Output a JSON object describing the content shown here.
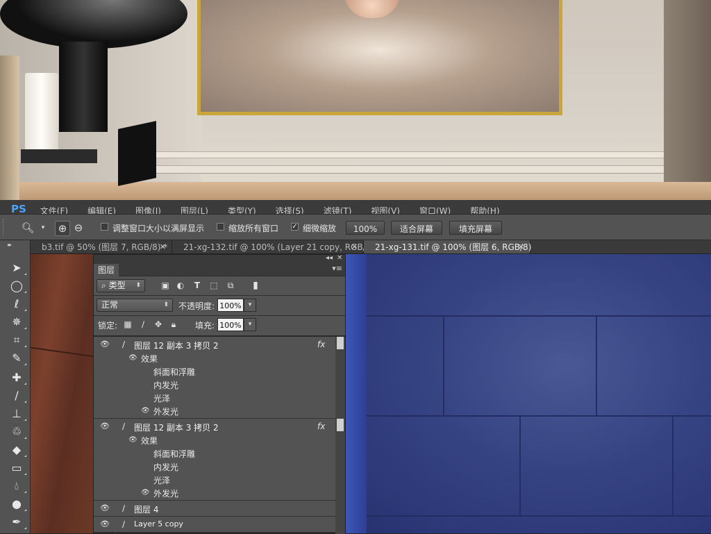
{
  "menu": {
    "logo": "PS",
    "items": [
      "文件(F)",
      "编辑(E)",
      "图像(I)",
      "图层(L)",
      "类型(Y)",
      "选择(S)",
      "滤镜(T)",
      "视图(V)",
      "窗口(W)",
      "帮助(H)"
    ]
  },
  "options": {
    "resize_windows_label": "调整窗口大小以满屏显示",
    "zoom_all_label": "缩放所有窗口",
    "scrubby_zoom_label": "细微缩放",
    "zoom_value_button": "100%",
    "fit_screen_button": "适合屏幕",
    "fill_screen_button": "填充屏幕",
    "resize_windows_checked": false,
    "zoom_all_checked": false,
    "scrubby_zoom_checked": true
  },
  "tabs": [
    {
      "label": "b3.tif @ 50% (图层 7, RGB/8) *",
      "active": false
    },
    {
      "label": "21-xg-132.tif @ 100% (Layer 21 copy, RGB/8)",
      "active": false
    },
    {
      "label": "21-xg-131.tif @ 100% (图层 6, RGB/8)",
      "active": true
    }
  ],
  "layers_panel": {
    "title": "图层",
    "filter_kind": "类型",
    "blend_mode": "正常",
    "opacity_label": "不透明度:",
    "opacity_value": "100%",
    "lock_label": "锁定:",
    "fill_label": "填充:",
    "fill_value": "100%",
    "layers": [
      {
        "name": "图层 12 副本 3 拷贝 2",
        "fx": "fx",
        "effects_label": "效果",
        "effects": [
          "斜面和浮雕",
          "内发光",
          "光泽",
          "外发光"
        ]
      },
      {
        "name": "图层 12 副本 3 拷贝 2",
        "fx": "fx",
        "effects_label": "效果",
        "effects": [
          "斜面和浮雕",
          "内发光",
          "光泽",
          "外发光"
        ]
      },
      {
        "name": "图层 4"
      },
      {
        "name": "Layer 5 copy"
      }
    ]
  },
  "colors": {
    "ui_panel": "#535353",
    "ui_dark": "#3a3a3a",
    "accent_logo": "#4aa3ff",
    "canvas_blue": "#364382",
    "canvas_brown": "#6d3926"
  }
}
